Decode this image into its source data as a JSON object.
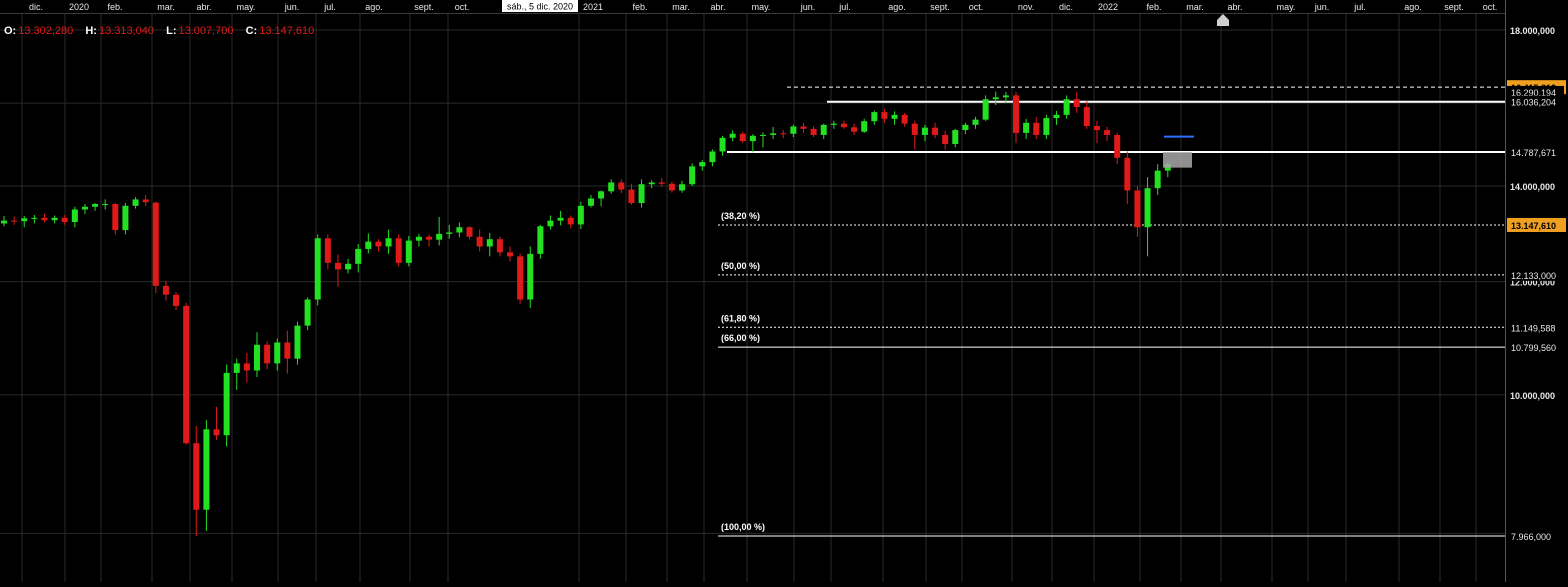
{
  "header": {
    "ohlc": [
      {
        "label": "O:",
        "value": "13.302,280"
      },
      {
        "label": "H:",
        "value": "13.313,040"
      },
      {
        "label": "L:",
        "value": "13.007,700"
      },
      {
        "label": "C:",
        "value": "13.147,610"
      }
    ],
    "cursor_date": "sáb., 5 dic. 2020"
  },
  "colors": {
    "background": "#000000",
    "grid": "#2a2a2a",
    "up": "#22e022",
    "down": "#e01919",
    "highlight_label": "#f0a020",
    "blue_mark": "#2f6fff"
  },
  "chart_data": {
    "type": "candlestick",
    "interval": "weekly",
    "x_axis_labels": [
      "dic.",
      "2020",
      "feb.",
      "mar.",
      "abr.",
      "may.",
      "jun.",
      "jul.",
      "ago.",
      "sept.",
      "oct.",
      "2021",
      "feb.",
      "mar.",
      "abr.",
      "may.",
      "jun.",
      "jul.",
      "ago.",
      "sept.",
      "oct.",
      "nov.",
      "dic.",
      "2022",
      "feb.",
      "mar.",
      "abr.",
      "may.",
      "jun.",
      "jul.",
      "ago.",
      "sept.",
      "oct."
    ],
    "y_axis": {
      "scale": "log",
      "ticks": [
        "18.000,000",
        "14.000,000",
        "12.000,000",
        "10.000,000"
      ],
      "tick_values": [
        18000,
        14000,
        12000,
        10000
      ]
    },
    "price_labels": [
      {
        "text": "16.415,812",
        "value": 16415.812,
        "highlight": true
      },
      {
        "text": "16.290,194",
        "value": 16290.194,
        "highlight": false
      },
      {
        "text": "16.036,204",
        "value": 16036.204,
        "highlight": false
      },
      {
        "text": "14.787,671",
        "value": 14787.671,
        "highlight": false
      },
      {
        "text": "13.147,610",
        "value": 13147.61,
        "highlight": true
      },
      {
        "text": "12.133,000",
        "value": 12133.0,
        "highlight": false
      },
      {
        "text": "11.149,588",
        "value": 11149.588,
        "highlight": false
      },
      {
        "text": "10.799,560",
        "value": 10799.56,
        "highlight": false
      },
      {
        "text": "7.966,000",
        "value": 7966.0,
        "highlight": false
      }
    ],
    "fibonacci_levels": [
      {
        "label": "(38,20 %)",
        "value": 13147.61,
        "style": "dotted"
      },
      {
        "label": "(50,00 %)",
        "value": 12133.0,
        "style": "dotted"
      },
      {
        "label": "(61,80 %)",
        "value": 11149.588,
        "style": "dotted"
      },
      {
        "label": "(66,00 %)",
        "value": 10799.56,
        "style": "solid"
      },
      {
        "label": "(100,00 %)",
        "value": 7966.0,
        "style": "solid"
      }
    ],
    "horizontal_lines": [
      {
        "value": 16415.812,
        "style": "dashed"
      },
      {
        "value": 16036.204,
        "style": "solid"
      },
      {
        "value": 14787.671,
        "style": "solid"
      }
    ],
    "candles": [
      [
        13180,
        13340,
        13120,
        13240
      ],
      [
        13240,
        13330,
        13150,
        13230
      ],
      [
        13230,
        13340,
        13100,
        13290
      ],
      [
        13290,
        13360,
        13180,
        13300
      ],
      [
        13300,
        13390,
        13200,
        13250
      ],
      [
        13250,
        13350,
        13180,
        13300
      ],
      [
        13300,
        13360,
        13150,
        13210
      ],
      [
        13210,
        13540,
        13100,
        13480
      ],
      [
        13480,
        13600,
        13380,
        13540
      ],
      [
        13540,
        13620,
        13450,
        13600
      ],
      [
        13600,
        13700,
        13480,
        13600
      ],
      [
        13600,
        13620,
        12950,
        13040
      ],
      [
        13040,
        13620,
        12950,
        13560
      ],
      [
        13560,
        13750,
        13500,
        13700
      ],
      [
        13700,
        13800,
        13550,
        13640
      ],
      [
        13630,
        13650,
        11780,
        11920
      ],
      [
        11920,
        12020,
        11640,
        11750
      ],
      [
        11750,
        11800,
        11460,
        11540
      ],
      [
        11540,
        11600,
        9230,
        9250
      ],
      [
        9250,
        9510,
        7966,
        8310
      ],
      [
        8310,
        9600,
        8030,
        9460
      ],
      [
        9460,
        9810,
        9300,
        9370
      ],
      [
        9370,
        10500,
        9200,
        10360
      ],
      [
        10360,
        10600,
        10080,
        10520
      ],
      [
        10520,
        10700,
        10200,
        10400
      ],
      [
        10400,
        11060,
        10290,
        10840
      ],
      [
        10840,
        10900,
        10420,
        10520
      ],
      [
        10520,
        10950,
        10400,
        10880
      ],
      [
        10880,
        11090,
        10350,
        10600
      ],
      [
        10600,
        11250,
        10500,
        11180
      ],
      [
        11180,
        11700,
        11100,
        11660
      ],
      [
        11660,
        12950,
        11550,
        12870
      ],
      [
        12870,
        12950,
        12240,
        12370
      ],
      [
        12370,
        12540,
        11900,
        12240
      ],
      [
        12240,
        12450,
        12160,
        12350
      ],
      [
        12350,
        12750,
        12180,
        12650
      ],
      [
        12650,
        12970,
        12560,
        12800
      ],
      [
        12800,
        12850,
        12600,
        12700
      ],
      [
        12700,
        13050,
        12550,
        12870
      ],
      [
        12870,
        12950,
        12300,
        12370
      ],
      [
        12370,
        12920,
        12300,
        12820
      ],
      [
        12820,
        12960,
        12700,
        12900
      ],
      [
        12900,
        12950,
        12700,
        12840
      ],
      [
        12840,
        13320,
        12720,
        12960
      ],
      [
        12960,
        13150,
        12860,
        12990
      ],
      [
        12990,
        13200,
        12890,
        13100
      ],
      [
        13100,
        13120,
        12850,
        12900
      ],
      [
        12900,
        13050,
        12600,
        12700
      ],
      [
        12700,
        12980,
        12500,
        12850
      ],
      [
        12850,
        12900,
        12500,
        12580
      ],
      [
        12580,
        12700,
        12400,
        12500
      ],
      [
        12500,
        12550,
        11580,
        11660
      ],
      [
        11660,
        12700,
        11500,
        12550
      ],
      [
        12550,
        13150,
        12450,
        13120
      ],
      [
        13120,
        13350,
        13050,
        13240
      ],
      [
        13240,
        13450,
        13140,
        13300
      ],
      [
        13300,
        13350,
        13080,
        13160
      ],
      [
        13160,
        13650,
        13060,
        13560
      ],
      [
        13560,
        13800,
        13520,
        13720
      ],
      [
        13720,
        13900,
        13550,
        13880
      ],
      [
        13880,
        14150,
        13830,
        14080
      ],
      [
        14080,
        14150,
        13840,
        13920
      ],
      [
        13920,
        14050,
        13580,
        13620
      ],
      [
        13620,
        14150,
        13520,
        14040
      ],
      [
        14040,
        14130,
        13950,
        14080
      ],
      [
        14080,
        14180,
        13980,
        14050
      ],
      [
        14050,
        14100,
        13850,
        13900
      ],
      [
        13900,
        14120,
        13850,
        14040
      ],
      [
        14040,
        14520,
        14000,
        14450
      ],
      [
        14450,
        14600,
        14350,
        14550
      ],
      [
        14550,
        14850,
        14450,
        14800
      ],
      [
        14800,
        15180,
        14700,
        15130
      ],
      [
        15130,
        15310,
        15050,
        15230
      ],
      [
        15230,
        15280,
        15000,
        15050
      ],
      [
        15050,
        15220,
        14780,
        15180
      ],
      [
        15180,
        15260,
        14900,
        15200
      ],
      [
        15200,
        15400,
        15100,
        15240
      ],
      [
        15240,
        15320,
        15120,
        15230
      ],
      [
        15230,
        15450,
        15150,
        15410
      ],
      [
        15410,
        15500,
        15250,
        15350
      ],
      [
        15350,
        15420,
        15150,
        15200
      ],
      [
        15200,
        15480,
        15100,
        15450
      ],
      [
        15450,
        15550,
        15350,
        15480
      ],
      [
        15480,
        15560,
        15350,
        15390
      ],
      [
        15390,
        15480,
        15200,
        15280
      ],
      [
        15280,
        15600,
        15250,
        15540
      ],
      [
        15540,
        15810,
        15450,
        15770
      ],
      [
        15770,
        15850,
        15500,
        15600
      ],
      [
        15600,
        15790,
        15450,
        15700
      ],
      [
        15700,
        15750,
        15400,
        15480
      ],
      [
        15480,
        15550,
        14850,
        15200
      ],
      [
        15200,
        15450,
        15050,
        15380
      ],
      [
        15380,
        15500,
        15120,
        15200
      ],
      [
        15200,
        15300,
        14850,
        14980
      ],
      [
        14980,
        15350,
        14900,
        15320
      ],
      [
        15320,
        15500,
        15220,
        15450
      ],
      [
        15450,
        15650,
        15350,
        15580
      ],
      [
        15580,
        16200,
        15550,
        16100
      ],
      [
        16100,
        16300,
        15950,
        16150
      ],
      [
        16150,
        16290,
        16000,
        16200
      ],
      [
        16200,
        16290,
        15000,
        15250
      ],
      [
        15250,
        15600,
        15100,
        15500
      ],
      [
        15500,
        15650,
        15100,
        15200
      ],
      [
        15200,
        15700,
        15100,
        15620
      ],
      [
        15620,
        15800,
        15450,
        15700
      ],
      [
        15700,
        16200,
        15600,
        16100
      ],
      [
        16100,
        16290,
        15750,
        15900
      ],
      [
        15900,
        16050,
        15350,
        15420
      ],
      [
        15420,
        15550,
        15000,
        15320
      ],
      [
        15320,
        15400,
        15050,
        15200
      ],
      [
        15200,
        15250,
        14500,
        14650
      ],
      [
        14650,
        14800,
        13600,
        13900
      ],
      [
        13900,
        14000,
        12900,
        13100
      ],
      [
        13100,
        14200,
        12500,
        13950
      ],
      [
        13950,
        14500,
        13800,
        14350
      ],
      [
        14350,
        14550,
        14200,
        14500
      ]
    ]
  }
}
